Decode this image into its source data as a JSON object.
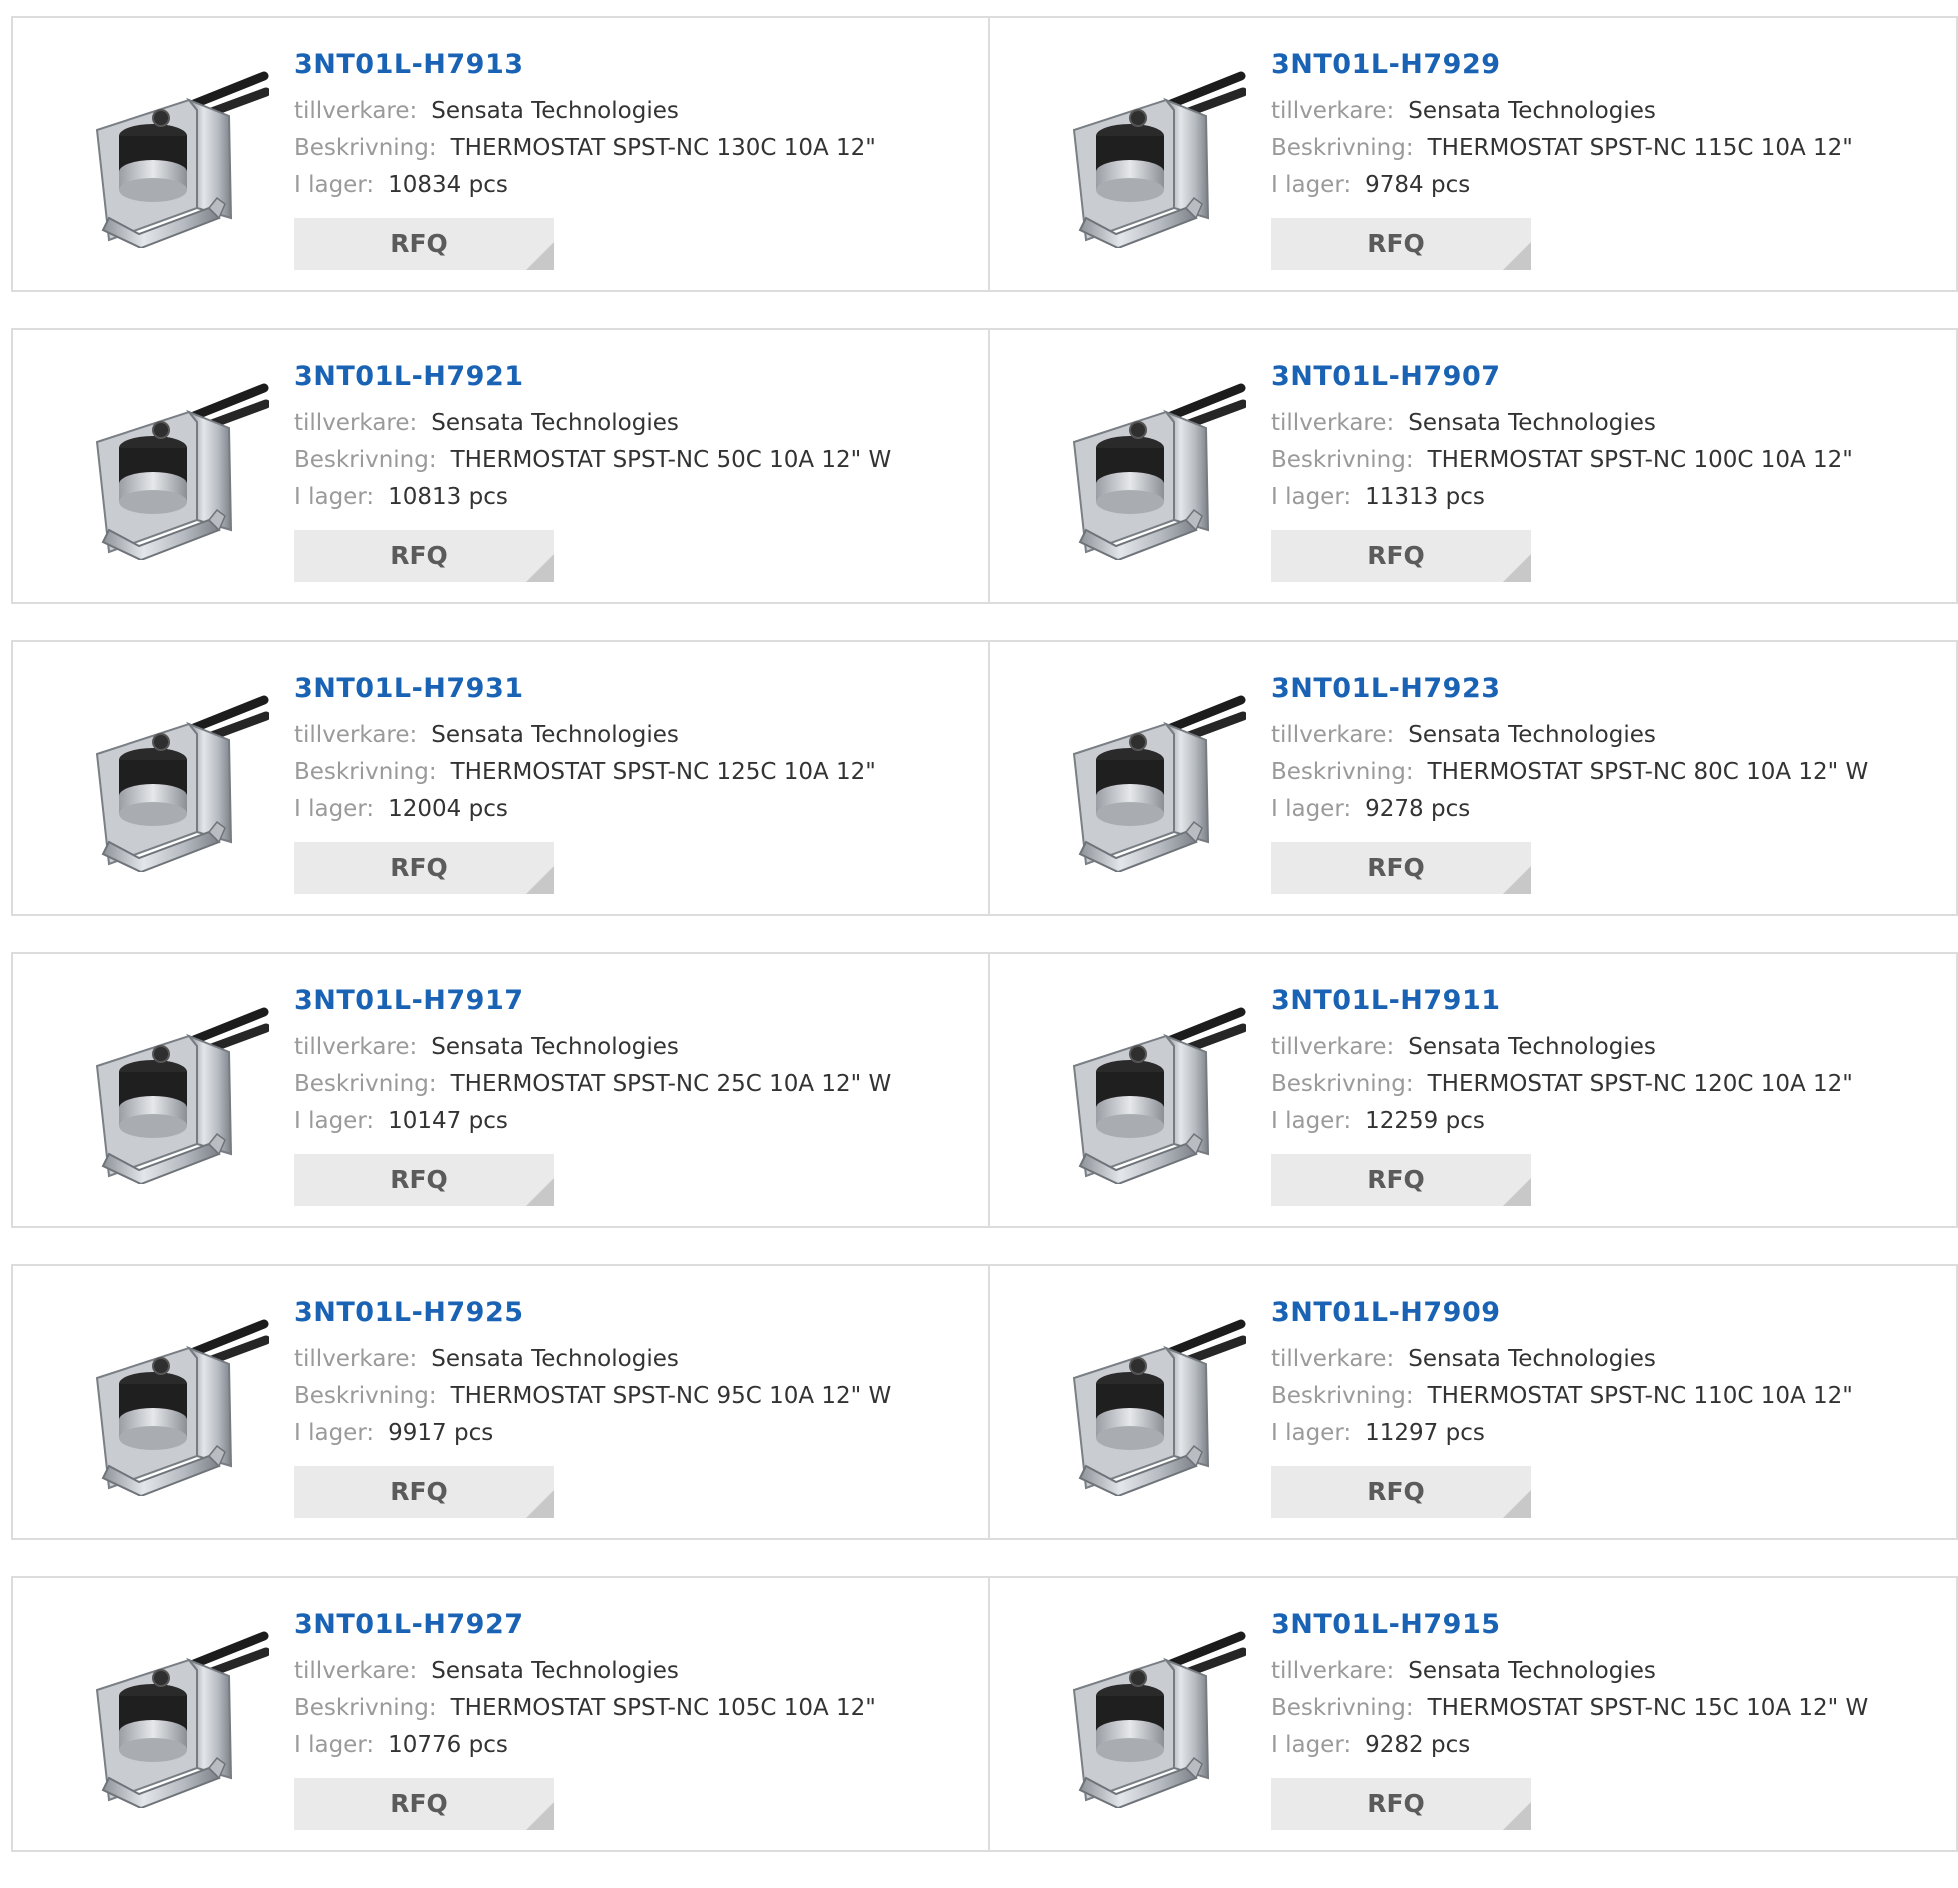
{
  "labels": {
    "manufacturer": "tillverkare:",
    "description": "Beskrivning:",
    "stock": "I lager:",
    "rfq": "RFQ"
  },
  "products": [
    {
      "part": "3NT01L-H7913",
      "manufacturer": "Sensata Technologies",
      "description": "THERMOSTAT SPST-NC 130C 10A 12\"",
      "stock": "10834 pcs"
    },
    {
      "part": "3NT01L-H7929",
      "manufacturer": "Sensata Technologies",
      "description": "THERMOSTAT SPST-NC 115C 10A 12\"",
      "stock": "9784 pcs"
    },
    {
      "part": "3NT01L-H7921",
      "manufacturer": "Sensata Technologies",
      "description": "THERMOSTAT SPST-NC 50C 10A 12\" W",
      "stock": "10813 pcs"
    },
    {
      "part": "3NT01L-H7907",
      "manufacturer": "Sensata Technologies",
      "description": "THERMOSTAT SPST-NC 100C 10A 12\"",
      "stock": "11313 pcs"
    },
    {
      "part": "3NT01L-H7931",
      "manufacturer": "Sensata Technologies",
      "description": "THERMOSTAT SPST-NC 125C 10A 12\"",
      "stock": "12004 pcs"
    },
    {
      "part": "3NT01L-H7923",
      "manufacturer": "Sensata Technologies",
      "description": "THERMOSTAT SPST-NC 80C 10A 12\" W",
      "stock": "9278 pcs"
    },
    {
      "part": "3NT01L-H7917",
      "manufacturer": "Sensata Technologies",
      "description": "THERMOSTAT SPST-NC 25C 10A 12\" W",
      "stock": "10147 pcs"
    },
    {
      "part": "3NT01L-H7911",
      "manufacturer": "Sensata Technologies",
      "description": "THERMOSTAT SPST-NC 120C 10A 12\"",
      "stock": "12259 pcs"
    },
    {
      "part": "3NT01L-H7925",
      "manufacturer": "Sensata Technologies",
      "description": "THERMOSTAT SPST-NC 95C 10A 12\" W",
      "stock": "9917 pcs"
    },
    {
      "part": "3NT01L-H7909",
      "manufacturer": "Sensata Technologies",
      "description": "THERMOSTAT SPST-NC 110C 10A 12\"",
      "stock": "11297 pcs"
    },
    {
      "part": "3NT01L-H7927",
      "manufacturer": "Sensata Technologies",
      "description": "THERMOSTAT SPST-NC 105C 10A 12\"",
      "stock": "10776 pcs"
    },
    {
      "part": "3NT01L-H7915",
      "manufacturer": "Sensata Technologies",
      "description": "THERMOSTAT SPST-NC 15C 10A 12\" W",
      "stock": "9282 pcs"
    }
  ],
  "colors": {
    "part_link": "#1a63b4",
    "label_gray": "#9a9a9a",
    "value_dark": "#333333",
    "card_border": "#dcdcdc",
    "rfq_bg": "#eaeaea"
  }
}
